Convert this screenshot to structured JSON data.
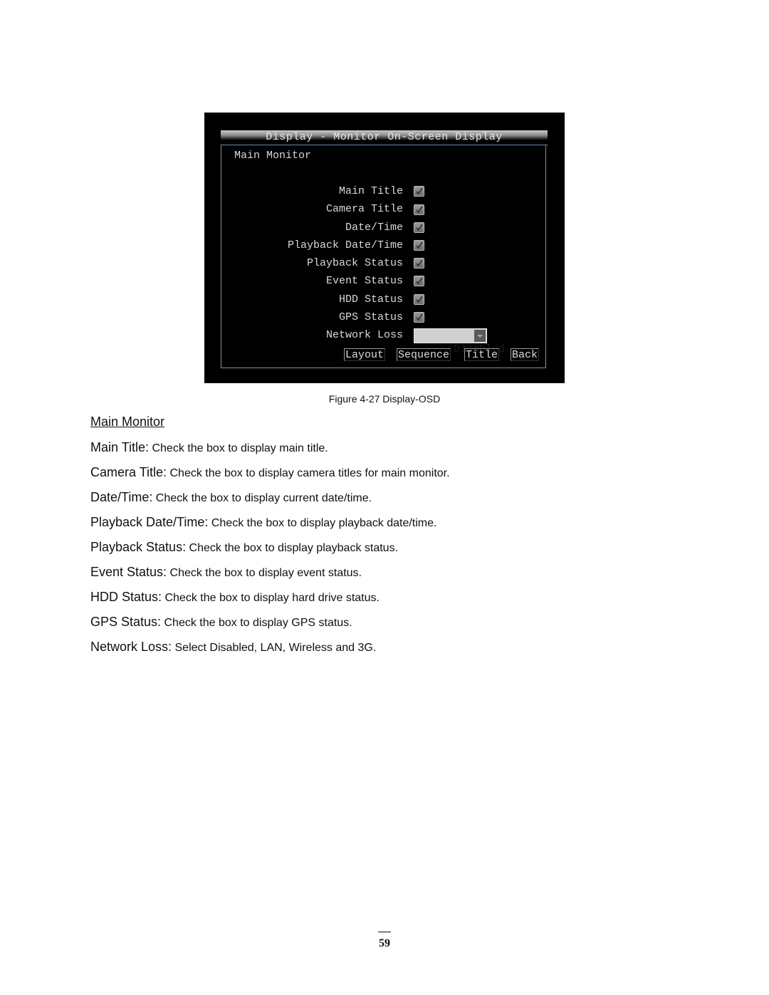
{
  "figure": {
    "window_title": "Display - Monitor On-Screen Display",
    "section_label": "Main Monitor",
    "options": [
      {
        "label": "Main Title",
        "type": "checkbox",
        "checked": true,
        "icon": "checkbox-checked-icon"
      },
      {
        "label": "Camera Title",
        "type": "checkbox",
        "checked": true,
        "icon": "checkbox-checked-icon"
      },
      {
        "label": "Date/Time",
        "type": "checkbox",
        "checked": true,
        "icon": "checkbox-checked-icon"
      },
      {
        "label": "Playback Date/Time",
        "type": "checkbox",
        "checked": true,
        "icon": "checkbox-checked-icon"
      },
      {
        "label": "Playback Status",
        "type": "checkbox",
        "checked": true,
        "icon": "checkbox-checked-icon"
      },
      {
        "label": "Event Status",
        "type": "checkbox",
        "checked": true,
        "icon": "checkbox-checked-icon"
      },
      {
        "label": "HDD Status",
        "type": "checkbox",
        "checked": true,
        "icon": "checkbox-checked-icon"
      },
      {
        "label": "GPS Status",
        "type": "checkbox",
        "checked": true,
        "icon": "checkbox-checked-icon"
      }
    ],
    "network_loss": {
      "label": "Network Loss",
      "value": "Disabled",
      "icon": "dropdown-arrow-icon"
    },
    "buttons": {
      "layout": "Layout",
      "sequence": "Sequence",
      "title": "Title",
      "back": "Back"
    },
    "caption": "Figure 4-27 Display-OSD"
  },
  "document": {
    "heading": "Main Monitor",
    "descriptions": [
      {
        "term": "Main Title:",
        "text": " Check the box to display main title."
      },
      {
        "term": "Camera Title:",
        "text": " Check the box to display camera titles for main monitor."
      },
      {
        "term": "Date/Time:",
        "text": " Check the box to display current date/time."
      },
      {
        "term": "Playback Date/Time:",
        "text": " Check the box to display playback date/time."
      },
      {
        "term": "Playback Status:",
        "text": " Check the box to display playback status."
      },
      {
        "term": "Event Status:",
        "text": " Check the box to display event status."
      },
      {
        "term": "HDD Status:",
        "text": " Check the box to display hard drive status."
      },
      {
        "term": "GPS Status:",
        "text": " Check the box to display GPS status."
      },
      {
        "term": "Network Loss:",
        "text": " Select Disabled, LAN, Wireless and 3G."
      }
    ],
    "page_number": "59"
  }
}
